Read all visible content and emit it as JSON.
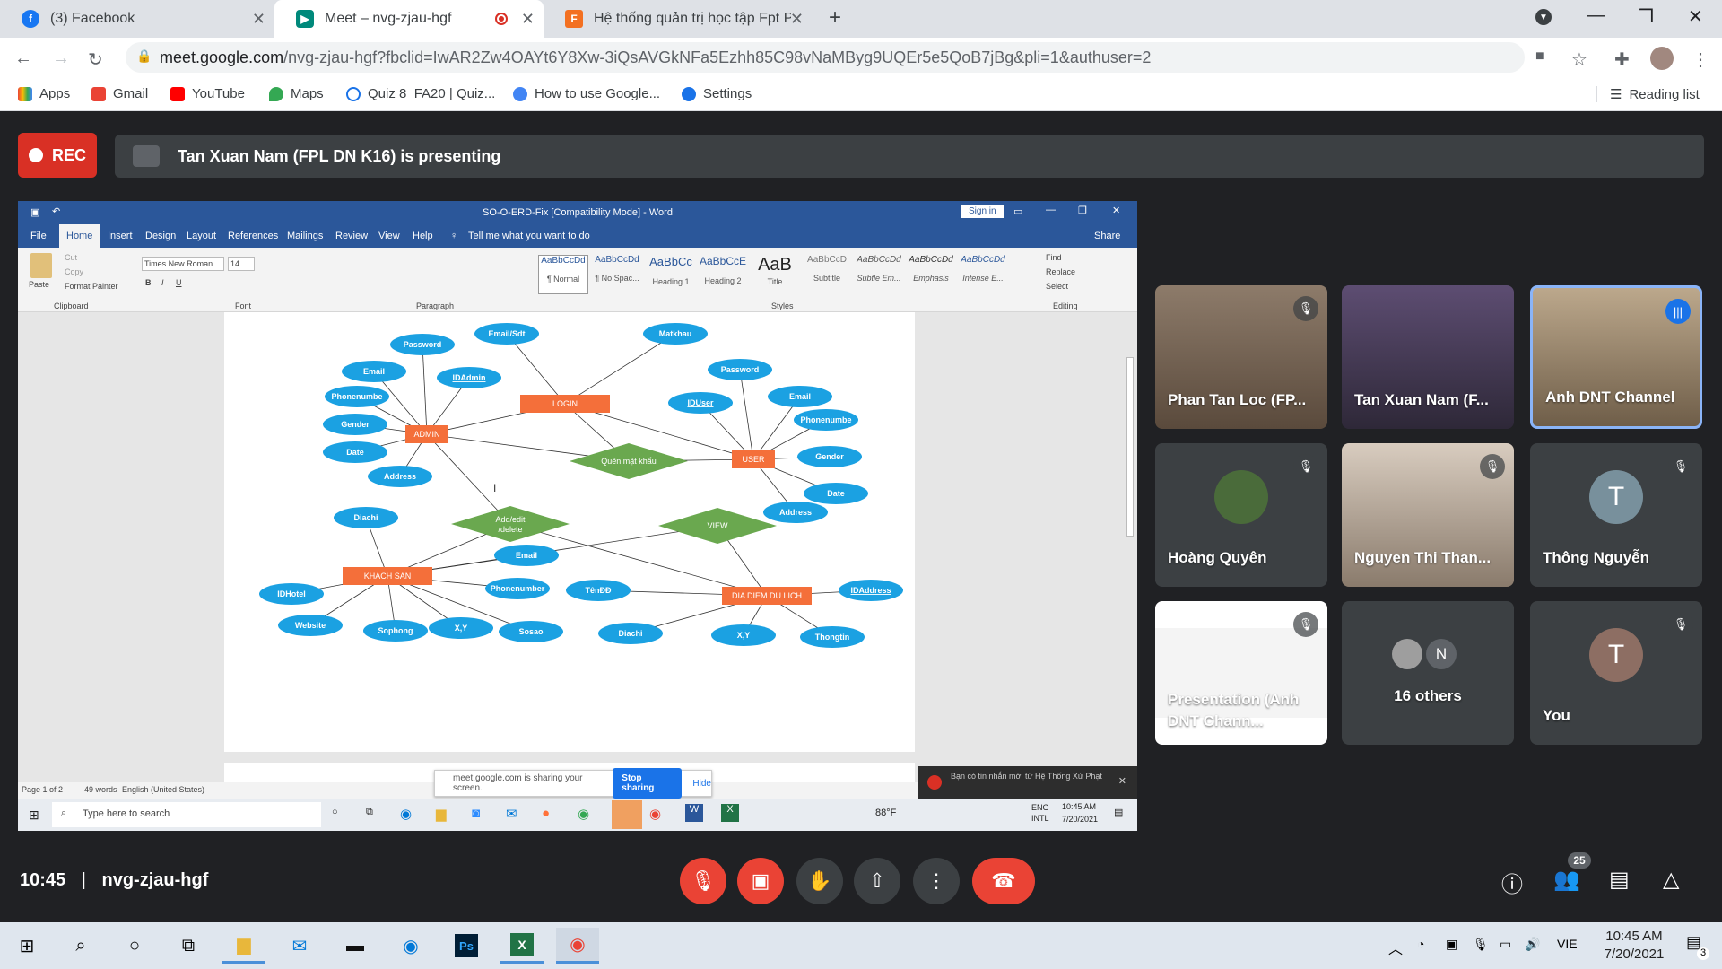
{
  "browser": {
    "tabs": [
      {
        "title": "(3) Facebook",
        "favicon": "facebook-icon"
      },
      {
        "title": "Meet – nvg-zjau-hgf",
        "favicon": "meet-icon",
        "recording": true
      },
      {
        "title": "Hệ thống quản trị học tập Fpt Po",
        "favicon": "fpt-icon"
      }
    ],
    "new_tab": "+",
    "url_host": "meet.google.com",
    "url_path": "/nvg-zjau-hgf?fbclid=IwAR2Zw4OAYt6Y8Xw-3iQsAVGkNFa5Ezhh85C98vNaMByg9UQEr5e5QoB7jBg&pli=1&authuser=2",
    "bookmarks": [
      {
        "label": "Apps",
        "color": "#ea4335"
      },
      {
        "label": "Gmail",
        "color": "#ea4335"
      },
      {
        "label": "YouTube",
        "color": "#ff0000"
      },
      {
        "label": "Maps",
        "color": "#34a853"
      },
      {
        "label": "Quiz 8_FA20 | Quiz...",
        "color": "#1a73e8"
      },
      {
        "label": "How to use Google...",
        "color": "#4285f4"
      },
      {
        "label": "Settings",
        "color": "#1a73e8"
      }
    ],
    "reading_list": "Reading list"
  },
  "meet": {
    "rec_label": "REC",
    "presenter_text": "Tan Xuan Nam (FPL DN K16) is presenting",
    "time": "10:45",
    "separator": "|",
    "meeting_code": "nvg-zjau-hgf",
    "participants_count": "25",
    "participants": [
      {
        "name": "Phan Tan Loc (FP...",
        "muted": true,
        "bg": "#6b5a4a"
      },
      {
        "name": "Tan Xuan Nam (F...",
        "muted": false,
        "bg": "#4a4058"
      },
      {
        "name": "Anh DNT Channel",
        "muted": false,
        "bg": "#8a7a64",
        "speaking": true
      },
      {
        "name": "Hoàng Quyên",
        "muted": true,
        "bg": "#3c4043",
        "avatar_letter": "",
        "avatar_color": "#4a6b3a"
      },
      {
        "name": "Nguyen Thi Than...",
        "muted": true,
        "bg": "#b8a99a"
      },
      {
        "name": "Thông Nguyễn",
        "muted": true,
        "bg": "#3c4043",
        "avatar_letter": "T",
        "avatar_color": "#78909c"
      },
      {
        "name": "Presentation (Anh DNT Chann...",
        "muted": true,
        "bg": "#ffffff"
      },
      {
        "name": "16 others",
        "muted": false,
        "bg": "#3c4043",
        "avatar_letter": "N",
        "avatar_color": "#5f6368"
      },
      {
        "name": "You",
        "muted": true,
        "bg": "#3c4043",
        "avatar_letter": "T",
        "avatar_color": "#8d6e63"
      }
    ]
  },
  "word": {
    "title": "SO-O-ERD-Fix [Compatibility Mode] - Word",
    "sign_in": "Sign in",
    "share": "Share",
    "menu": [
      "File",
      "Home",
      "Insert",
      "Design",
      "Layout",
      "References",
      "Mailings",
      "Review",
      "View",
      "Help"
    ],
    "tell_me": "Tell me what you want to do",
    "font_name": "Times New Roman",
    "font_size": "14",
    "paste": "Paste",
    "cut": "Cut",
    "copy": "Copy",
    "format_painter": "Format Painter",
    "groups": [
      "Clipboard",
      "Font",
      "Paragraph",
      "Styles",
      "Editing"
    ],
    "styles": [
      {
        "preview": "AaBbCcDd",
        "name": "¶ Normal"
      },
      {
        "preview": "AaBbCcDd",
        "name": "¶ No Spac..."
      },
      {
        "preview": "AaBbCc",
        "name": "Heading 1"
      },
      {
        "preview": "AaBbCcE",
        "name": "Heading 2"
      },
      {
        "preview": "AaB",
        "name": "Title"
      },
      {
        "preview": "AaBbCcD",
        "name": "Subtitle"
      },
      {
        "preview": "AaBbCcDd",
        "name": "Subtle Em..."
      },
      {
        "preview": "AaBbCcDd",
        "name": "Emphasis"
      },
      {
        "preview": "AaBbCcDd",
        "name": "Intense E..."
      }
    ],
    "editing": [
      "Find",
      "Replace",
      "Select"
    ],
    "status_page": "Page 1 of 2",
    "status_words": "49 words",
    "status_lang": "English (United States)",
    "sharing_text": "meet.google.com is sharing your screen.",
    "stop_sharing": "Stop sharing",
    "hide": "Hide",
    "notif_text": "Bạn có tin nhắn mới từ Hệ Thống Xử Phạt",
    "search_placeholder": "Type here to search",
    "temp": "88°F",
    "kbd": "ENG INTL",
    "clock_time": "10:45 AM",
    "clock_date": "7/20/2021"
  },
  "erd": {
    "entities": [
      {
        "id": "login",
        "label": "LOGIN"
      },
      {
        "id": "admin",
        "label": "ADMIN"
      },
      {
        "id": "user",
        "label": "USER"
      },
      {
        "id": "khachsan",
        "label": "KHACH SAN"
      },
      {
        "id": "diadiem",
        "label": "DIA DIEM DU LICH"
      }
    ],
    "relations": [
      {
        "id": "quenmk",
        "label": "Quên mật khẩu"
      },
      {
        "id": "addedit",
        "label": "Add/edit /delete"
      },
      {
        "id": "view",
        "label": "VIEW"
      }
    ],
    "attributes": [
      {
        "label": "Email/Sdt",
        "key": false
      },
      {
        "label": "Matkhau",
        "key": false
      },
      {
        "label": "Password",
        "key": false
      },
      {
        "label": "IDAdmin",
        "key": true
      },
      {
        "label": "Email",
        "key": false
      },
      {
        "label": "Phonenumbe",
        "key": false
      },
      {
        "label": "Gender",
        "key": false
      },
      {
        "label": "Date",
        "key": false
      },
      {
        "label": "Address",
        "key": false
      },
      {
        "label": "Password",
        "key": false
      },
      {
        "label": "IDUser",
        "key": true
      },
      {
        "label": "Email",
        "key": false
      },
      {
        "label": "Phonenumbe",
        "key": false
      },
      {
        "label": "Gender",
        "key": false
      },
      {
        "label": "Date",
        "key": false
      },
      {
        "label": "Address",
        "key": false
      },
      {
        "label": "Diachi",
        "key": false
      },
      {
        "label": "Email",
        "key": false
      },
      {
        "label": "IDHotel",
        "key": true
      },
      {
        "label": "Phonenumber",
        "key": false
      },
      {
        "label": "Website",
        "key": false
      },
      {
        "label": "Sophong",
        "key": false
      },
      {
        "label": "X,Y",
        "key": false
      },
      {
        "label": "Sosao",
        "key": false
      },
      {
        "label": "TênĐĐ",
        "key": false
      },
      {
        "label": "IDAddress",
        "key": true
      },
      {
        "label": "Diachi",
        "key": false
      },
      {
        "label": "X,Y",
        "key": false
      },
      {
        "label": "Thongtin",
        "key": false
      }
    ]
  },
  "os": {
    "clock_time": "10:45 AM",
    "clock_date": "7/20/2021",
    "lang": "VIE",
    "notif_count": "3"
  }
}
